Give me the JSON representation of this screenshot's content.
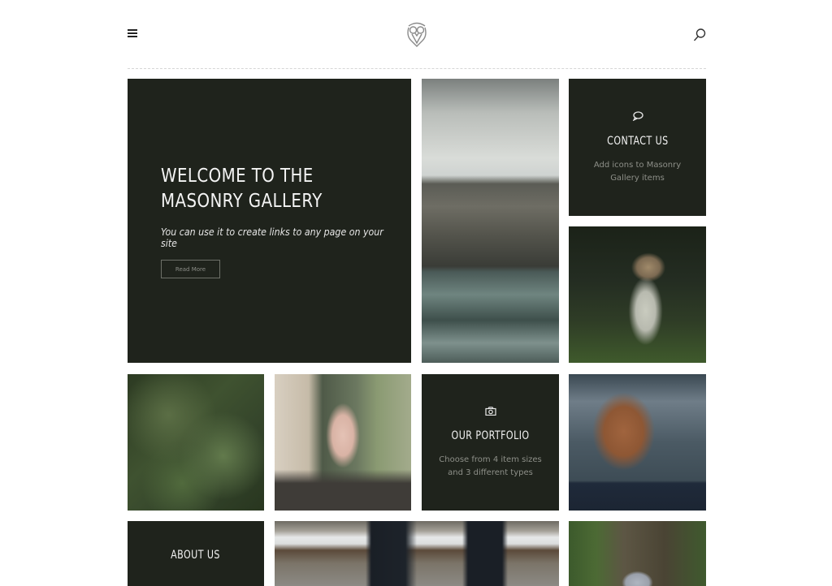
{
  "header": {
    "menu_icon": "hamburger-menu-icon",
    "logo_icon": "owl-logo-icon",
    "search_icon": "search-icon"
  },
  "hero": {
    "title": "WELCOME TO THE MASONRY GALLERY",
    "subtitle": "You can use it to create links to any page on your site",
    "button_label": "Read More"
  },
  "tiles": {
    "contact": {
      "icon": "chat-bubble-icon",
      "title": "CONTACT US",
      "description": "Add icons to Masonry Gallery items"
    },
    "portfolio": {
      "icon": "camera-icon",
      "title": "OUR PORTFOLIO",
      "description": "Choose from 4 item sizes and 3 different types"
    },
    "about": {
      "title": "ABOUT US"
    }
  },
  "photos": [
    {
      "subject": "rocky cliff by the sea"
    },
    {
      "subject": "woman in white dress in dark forest"
    },
    {
      "subject": "pine tree branches"
    },
    {
      "subject": "girl in pink dress with camo jacket by van"
    },
    {
      "subject": "woman with braided red hair by water"
    },
    {
      "subject": "legs in dark jeans over snowy ground"
    },
    {
      "subject": "stone wall with ivy"
    }
  ],
  "colors": {
    "tile_dark": "#1f231c",
    "title_text": "#f2f2f2",
    "muted_text": "#8d8f88"
  }
}
